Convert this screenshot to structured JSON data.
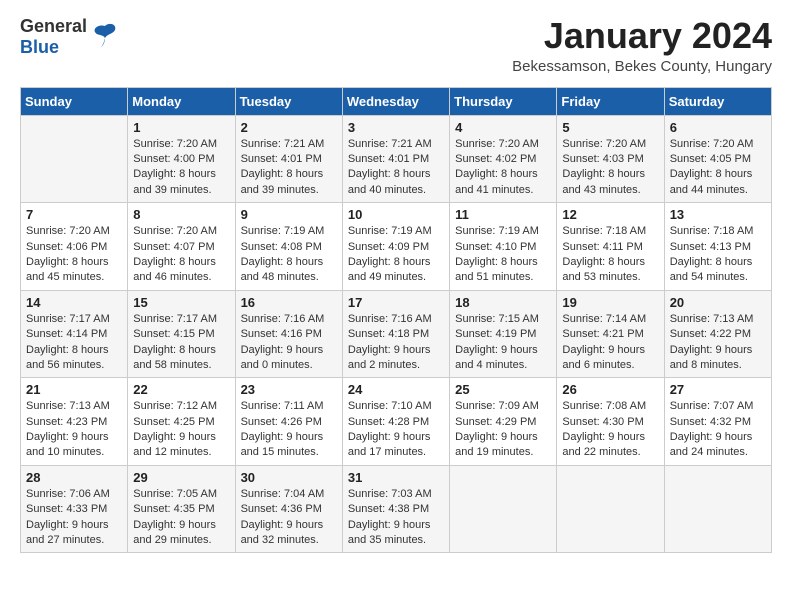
{
  "logo": {
    "general": "General",
    "blue": "Blue"
  },
  "header": {
    "month_title": "January 2024",
    "subtitle": "Bekessamson, Bekes County, Hungary"
  },
  "weekdays": [
    "Sunday",
    "Monday",
    "Tuesday",
    "Wednesday",
    "Thursday",
    "Friday",
    "Saturday"
  ],
  "weeks": [
    [
      {
        "day": "",
        "sunrise": "",
        "sunset": "",
        "daylight": ""
      },
      {
        "day": "1",
        "sunrise": "Sunrise: 7:20 AM",
        "sunset": "Sunset: 4:00 PM",
        "daylight": "Daylight: 8 hours and 39 minutes."
      },
      {
        "day": "2",
        "sunrise": "Sunrise: 7:21 AM",
        "sunset": "Sunset: 4:01 PM",
        "daylight": "Daylight: 8 hours and 39 minutes."
      },
      {
        "day": "3",
        "sunrise": "Sunrise: 7:21 AM",
        "sunset": "Sunset: 4:01 PM",
        "daylight": "Daylight: 8 hours and 40 minutes."
      },
      {
        "day": "4",
        "sunrise": "Sunrise: 7:20 AM",
        "sunset": "Sunset: 4:02 PM",
        "daylight": "Daylight: 8 hours and 41 minutes."
      },
      {
        "day": "5",
        "sunrise": "Sunrise: 7:20 AM",
        "sunset": "Sunset: 4:03 PM",
        "daylight": "Daylight: 8 hours and 43 minutes."
      },
      {
        "day": "6",
        "sunrise": "Sunrise: 7:20 AM",
        "sunset": "Sunset: 4:05 PM",
        "daylight": "Daylight: 8 hours and 44 minutes."
      }
    ],
    [
      {
        "day": "7",
        "sunrise": "Sunrise: 7:20 AM",
        "sunset": "Sunset: 4:06 PM",
        "daylight": "Daylight: 8 hours and 45 minutes."
      },
      {
        "day": "8",
        "sunrise": "Sunrise: 7:20 AM",
        "sunset": "Sunset: 4:07 PM",
        "daylight": "Daylight: 8 hours and 46 minutes."
      },
      {
        "day": "9",
        "sunrise": "Sunrise: 7:19 AM",
        "sunset": "Sunset: 4:08 PM",
        "daylight": "Daylight: 8 hours and 48 minutes."
      },
      {
        "day": "10",
        "sunrise": "Sunrise: 7:19 AM",
        "sunset": "Sunset: 4:09 PM",
        "daylight": "Daylight: 8 hours and 49 minutes."
      },
      {
        "day": "11",
        "sunrise": "Sunrise: 7:19 AM",
        "sunset": "Sunset: 4:10 PM",
        "daylight": "Daylight: 8 hours and 51 minutes."
      },
      {
        "day": "12",
        "sunrise": "Sunrise: 7:18 AM",
        "sunset": "Sunset: 4:11 PM",
        "daylight": "Daylight: 8 hours and 53 minutes."
      },
      {
        "day": "13",
        "sunrise": "Sunrise: 7:18 AM",
        "sunset": "Sunset: 4:13 PM",
        "daylight": "Daylight: 8 hours and 54 minutes."
      }
    ],
    [
      {
        "day": "14",
        "sunrise": "Sunrise: 7:17 AM",
        "sunset": "Sunset: 4:14 PM",
        "daylight": "Daylight: 8 hours and 56 minutes."
      },
      {
        "day": "15",
        "sunrise": "Sunrise: 7:17 AM",
        "sunset": "Sunset: 4:15 PM",
        "daylight": "Daylight: 8 hours and 58 minutes."
      },
      {
        "day": "16",
        "sunrise": "Sunrise: 7:16 AM",
        "sunset": "Sunset: 4:16 PM",
        "daylight": "Daylight: 9 hours and 0 minutes."
      },
      {
        "day": "17",
        "sunrise": "Sunrise: 7:16 AM",
        "sunset": "Sunset: 4:18 PM",
        "daylight": "Daylight: 9 hours and 2 minutes."
      },
      {
        "day": "18",
        "sunrise": "Sunrise: 7:15 AM",
        "sunset": "Sunset: 4:19 PM",
        "daylight": "Daylight: 9 hours and 4 minutes."
      },
      {
        "day": "19",
        "sunrise": "Sunrise: 7:14 AM",
        "sunset": "Sunset: 4:21 PM",
        "daylight": "Daylight: 9 hours and 6 minutes."
      },
      {
        "day": "20",
        "sunrise": "Sunrise: 7:13 AM",
        "sunset": "Sunset: 4:22 PM",
        "daylight": "Daylight: 9 hours and 8 minutes."
      }
    ],
    [
      {
        "day": "21",
        "sunrise": "Sunrise: 7:13 AM",
        "sunset": "Sunset: 4:23 PM",
        "daylight": "Daylight: 9 hours and 10 minutes."
      },
      {
        "day": "22",
        "sunrise": "Sunrise: 7:12 AM",
        "sunset": "Sunset: 4:25 PM",
        "daylight": "Daylight: 9 hours and 12 minutes."
      },
      {
        "day": "23",
        "sunrise": "Sunrise: 7:11 AM",
        "sunset": "Sunset: 4:26 PM",
        "daylight": "Daylight: 9 hours and 15 minutes."
      },
      {
        "day": "24",
        "sunrise": "Sunrise: 7:10 AM",
        "sunset": "Sunset: 4:28 PM",
        "daylight": "Daylight: 9 hours and 17 minutes."
      },
      {
        "day": "25",
        "sunrise": "Sunrise: 7:09 AM",
        "sunset": "Sunset: 4:29 PM",
        "daylight": "Daylight: 9 hours and 19 minutes."
      },
      {
        "day": "26",
        "sunrise": "Sunrise: 7:08 AM",
        "sunset": "Sunset: 4:30 PM",
        "daylight": "Daylight: 9 hours and 22 minutes."
      },
      {
        "day": "27",
        "sunrise": "Sunrise: 7:07 AM",
        "sunset": "Sunset: 4:32 PM",
        "daylight": "Daylight: 9 hours and 24 minutes."
      }
    ],
    [
      {
        "day": "28",
        "sunrise": "Sunrise: 7:06 AM",
        "sunset": "Sunset: 4:33 PM",
        "daylight": "Daylight: 9 hours and 27 minutes."
      },
      {
        "day": "29",
        "sunrise": "Sunrise: 7:05 AM",
        "sunset": "Sunset: 4:35 PM",
        "daylight": "Daylight: 9 hours and 29 minutes."
      },
      {
        "day": "30",
        "sunrise": "Sunrise: 7:04 AM",
        "sunset": "Sunset: 4:36 PM",
        "daylight": "Daylight: 9 hours and 32 minutes."
      },
      {
        "day": "31",
        "sunrise": "Sunrise: 7:03 AM",
        "sunset": "Sunset: 4:38 PM",
        "daylight": "Daylight: 9 hours and 35 minutes."
      },
      {
        "day": "",
        "sunrise": "",
        "sunset": "",
        "daylight": ""
      },
      {
        "day": "",
        "sunrise": "",
        "sunset": "",
        "daylight": ""
      },
      {
        "day": "",
        "sunrise": "",
        "sunset": "",
        "daylight": ""
      }
    ]
  ]
}
